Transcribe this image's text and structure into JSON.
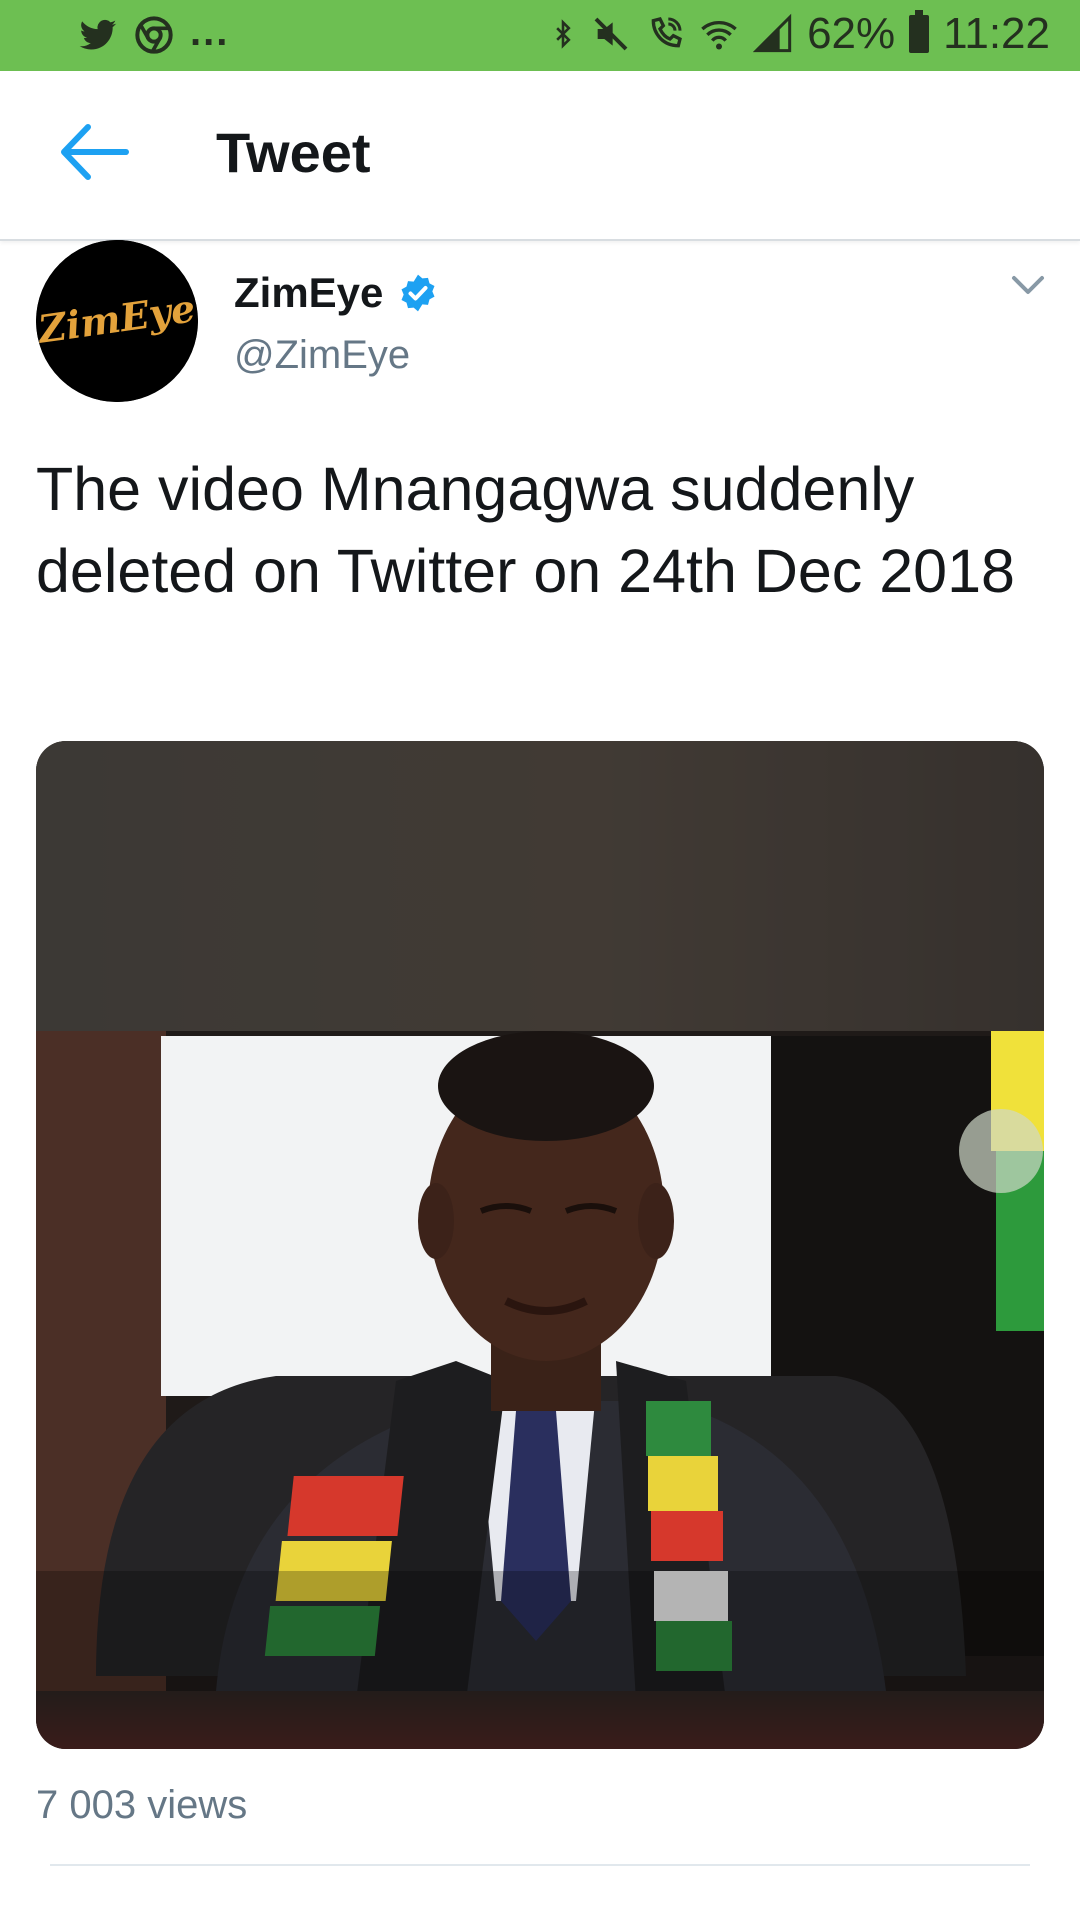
{
  "status_bar": {
    "left_icons": [
      "twitter-icon",
      "chrome-icon"
    ],
    "overflow": "...",
    "right_icons": [
      "bluetooth-icon",
      "mute-icon",
      "wifi-calling-icon",
      "wifi-icon",
      "signal-icon"
    ],
    "battery": "62%",
    "time": "11:22",
    "background_color": "#6dbf52"
  },
  "header": {
    "back_icon": "back-arrow-icon",
    "title": "Tweet",
    "accent_color": "#1da1f2"
  },
  "tweet": {
    "author": {
      "avatar_text": "ZimEye",
      "name": "ZimEye",
      "verified": true,
      "handle": "@ZimEye"
    },
    "menu_icon": "chevron-down-icon",
    "text": "The video Mnangagwa suddenly deleted on Twitter on 24th Dec 2018",
    "media": {
      "type": "video-thumbnail"
    },
    "views": "7 003 views"
  }
}
